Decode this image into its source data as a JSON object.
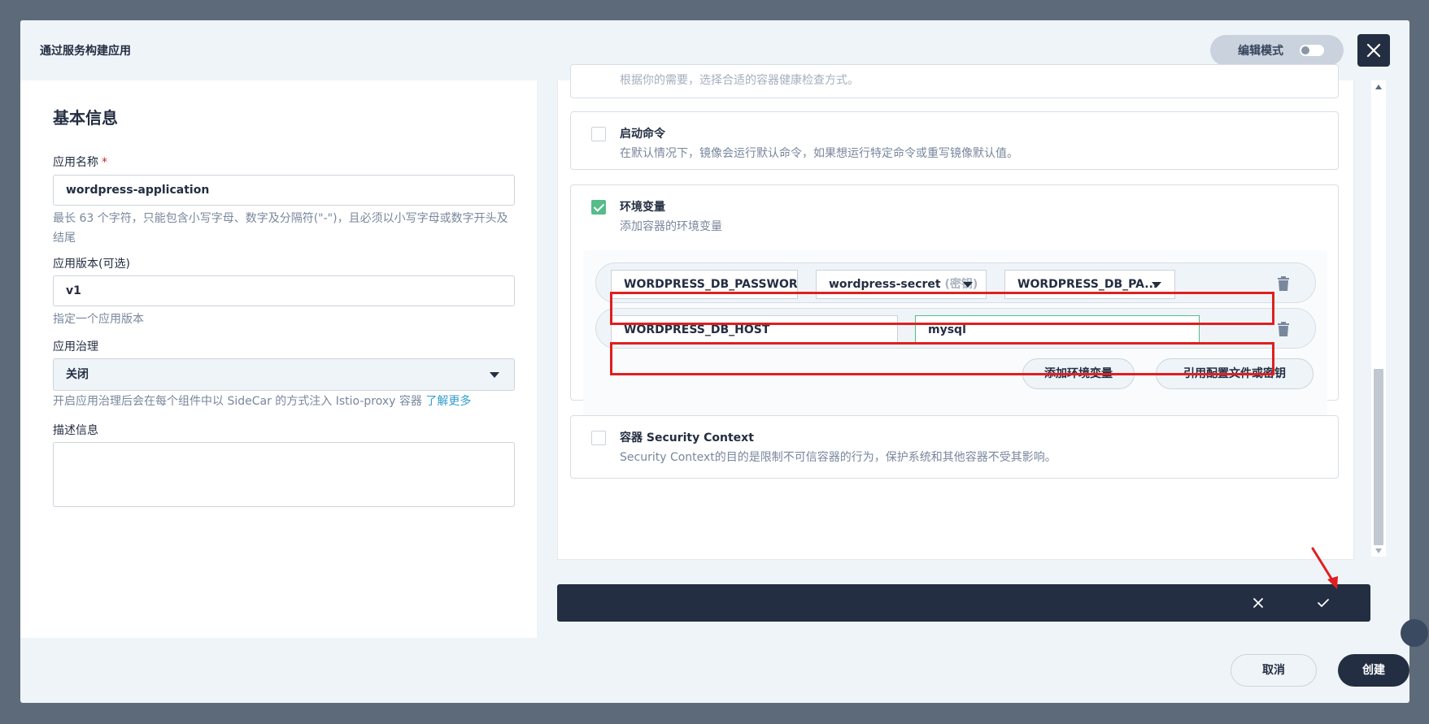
{
  "header": {
    "title": "通过服务构建应用",
    "edit_mode_label": "编辑模式"
  },
  "basic": {
    "section_title": "基本信息",
    "app_name_label": "应用名称",
    "required_mark": "*",
    "app_name_value": "wordpress-application",
    "app_name_hint": "最长 63 个字符，只能包含小写字母、数字及分隔符(\"-\")，且必须以小写字母或数字开头及结尾",
    "version_label": "应用版本(可选)",
    "version_value": "v1",
    "version_hint": "指定一个应用版本",
    "governance_label": "应用治理",
    "governance_value": "关闭",
    "governance_hint": "开启应用治理后会在每个组件中以 SideCar 的方式注入 Istio-proxy 容器",
    "learn_more": "了解更多",
    "description_label": "描述信息",
    "description_value": ""
  },
  "settings": {
    "partial_desc": "根据你的需要，选择合适的容器健康检查方式。",
    "start_cmd": {
      "title": "启动命令",
      "desc": "在默认情况下，镜像会运行默认命令，如果想运行特定命令或重写镜像默认值。",
      "checked": false
    },
    "env": {
      "title": "环境变量",
      "desc": "添加容器的环境变量",
      "checked": true,
      "rows": [
        {
          "name": "WORDPRESS_DB_PASSWORD",
          "secret": "wordpress-secret",
          "secret_tag": "(密钥)",
          "key": "WORDPRESS_DB_PA..."
        },
        {
          "name": "WORDPRESS_DB_HOST",
          "value": "mysql"
        }
      ],
      "add_btn": "添加环境变量",
      "ref_btn": "引用配置文件或密钥"
    },
    "security": {
      "title": "容器 Security Context",
      "desc": "Security Context的目的是限制不可信容器的行为，保护系统和其他容器不受其影响。",
      "checked": false
    }
  },
  "footer": {
    "cancel": "取消",
    "create": "创建"
  },
  "colors": {
    "accent_green": "#55bc8a",
    "dark": "#242e42",
    "highlight_red": "#e01f20",
    "link": "#329dce"
  }
}
